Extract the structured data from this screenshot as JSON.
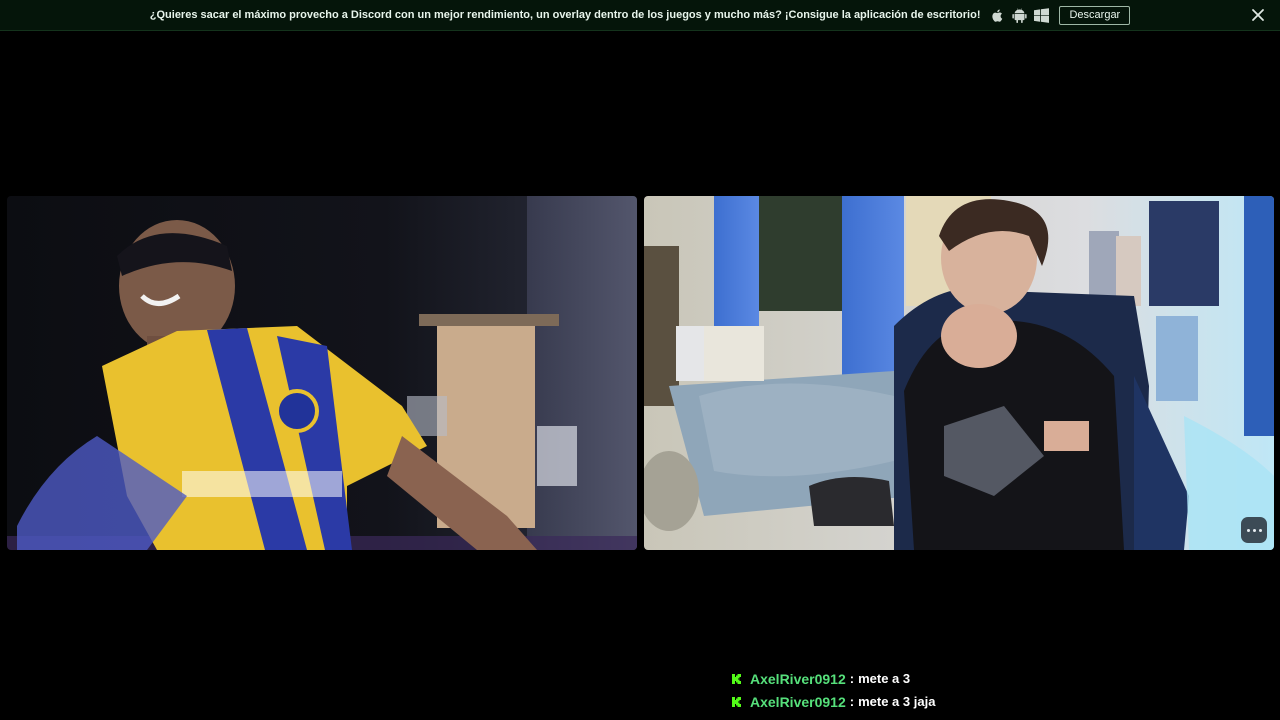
{
  "banner": {
    "text": "¿Quieres sacar el máximo provecho a Discord con un mejor rendimiento, un overlay dentro de los juegos y mucho más? ¡Consigue la aplicación de escritorio!",
    "os_icons": [
      "apple-icon",
      "android-icon",
      "windows-icon"
    ],
    "download_label": "Descargar",
    "close_icon": "close-icon"
  },
  "videos": [
    {
      "name": "left-video-feed"
    },
    {
      "name": "right-video-feed",
      "more_icon": "more-options-icon"
    }
  ],
  "chat": {
    "messages": [
      {
        "user": "AxelRiver0912",
        "separator": ":",
        "text": "mete a 3"
      },
      {
        "user": "AxelRiver0912",
        "separator": ":",
        "text": "mete a 3 jaja"
      }
    ]
  },
  "colors": {
    "banner_bg": "#05150a",
    "username": "#56e07b",
    "kick_green": "#53fc18",
    "page_bg": "#000000"
  }
}
